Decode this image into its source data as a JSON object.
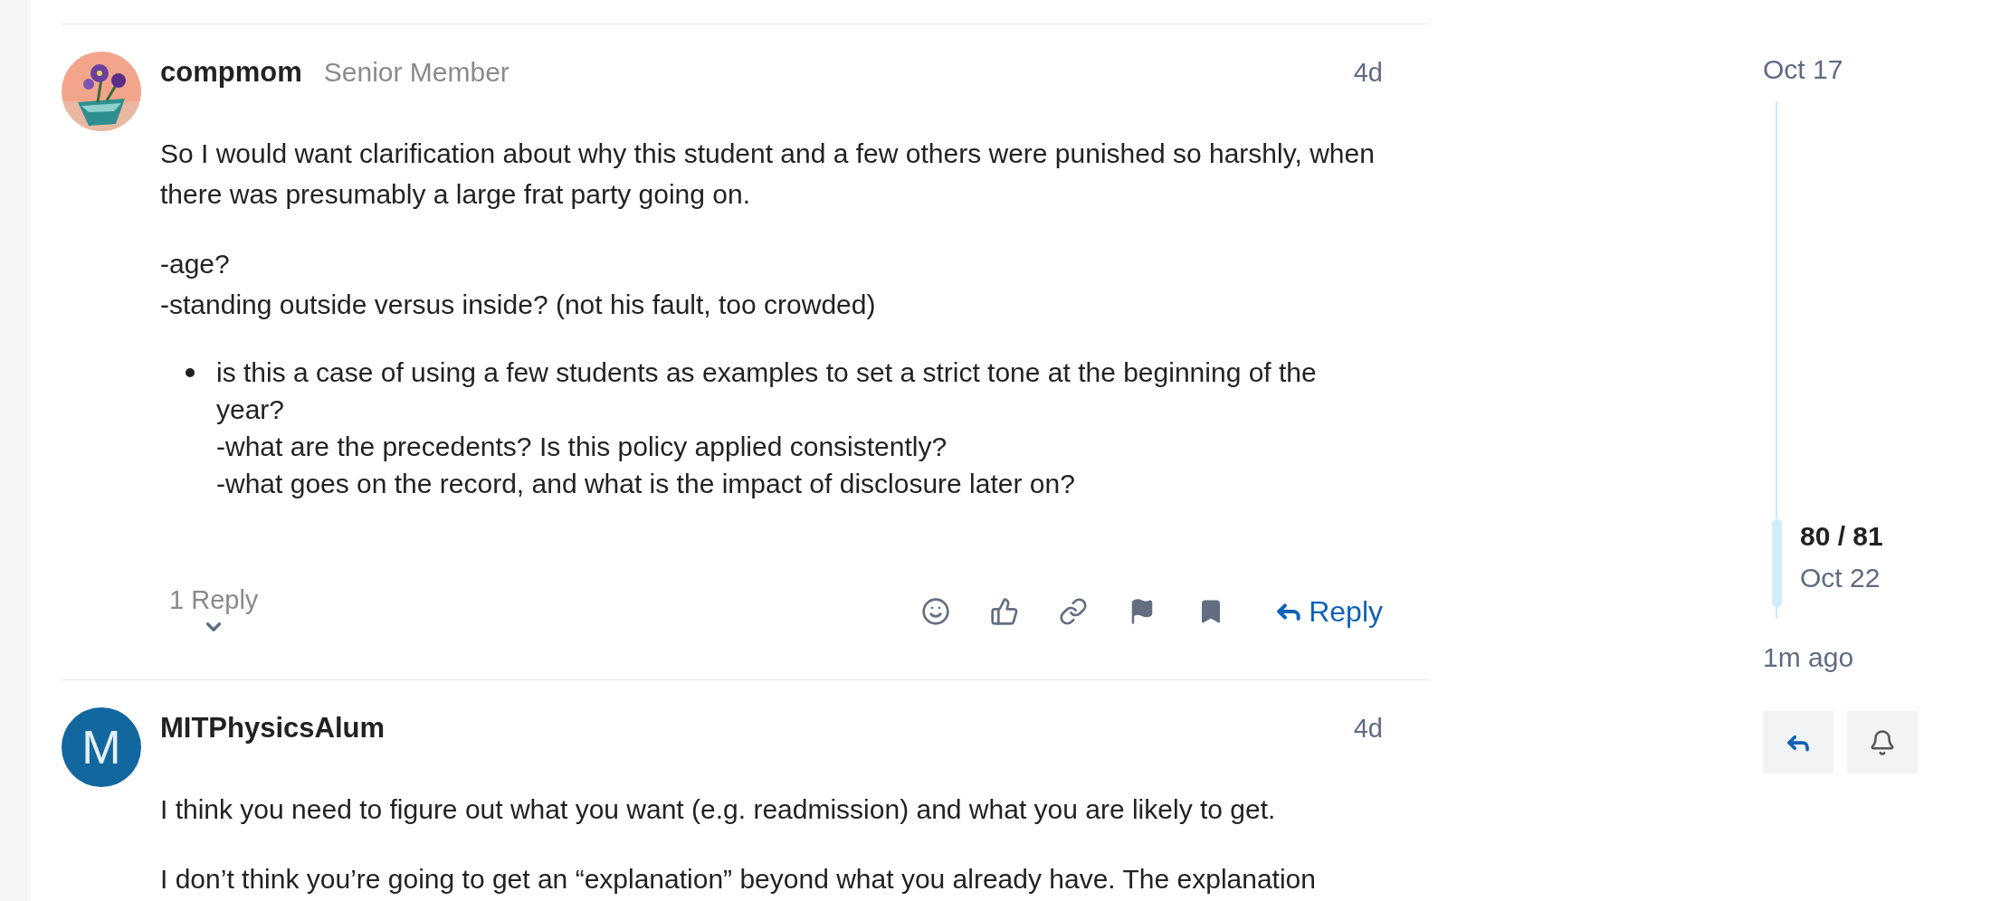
{
  "posts": [
    {
      "author": "compmom",
      "user_title": "Senior Member",
      "age": "4d",
      "body": [
        {
          "kind": "paragraph",
          "text": "So I would want clarification about why this student and a few others were punished so harshly, when there was presumably a large frat party going on."
        },
        {
          "kind": "paragraph",
          "text": "-age?\n-standing outside versus inside? (not his fault, too crowded)"
        },
        {
          "kind": "bullet",
          "text": "is this a case of using a few students as examples to set a strict tone at the beginning of the year?\n-what are the precedents? Is this policy applied consistently?\n-what goes on the record, and what is the impact of disclosure later on?"
        }
      ],
      "replies_toggle": "1 Reply",
      "reply_button": "Reply"
    },
    {
      "author": "MITPhysicsAlum",
      "age": "4d",
      "avatar": {
        "kind": "letter",
        "letter": "M"
      },
      "body": [
        {
          "kind": "paragraph",
          "text": "I think you need to figure out what you want (e.g. readmission) and what you are likely to get."
        },
        {
          "kind": "paragraph",
          "text": "I don’t think you’re going to get an “explanation” beyond what you already have. The explanation"
        }
      ]
    }
  ],
  "timeline": {
    "start": "Oct 17",
    "position": "80 / 81",
    "position_date": "Oct 22",
    "end": "1m ago"
  }
}
